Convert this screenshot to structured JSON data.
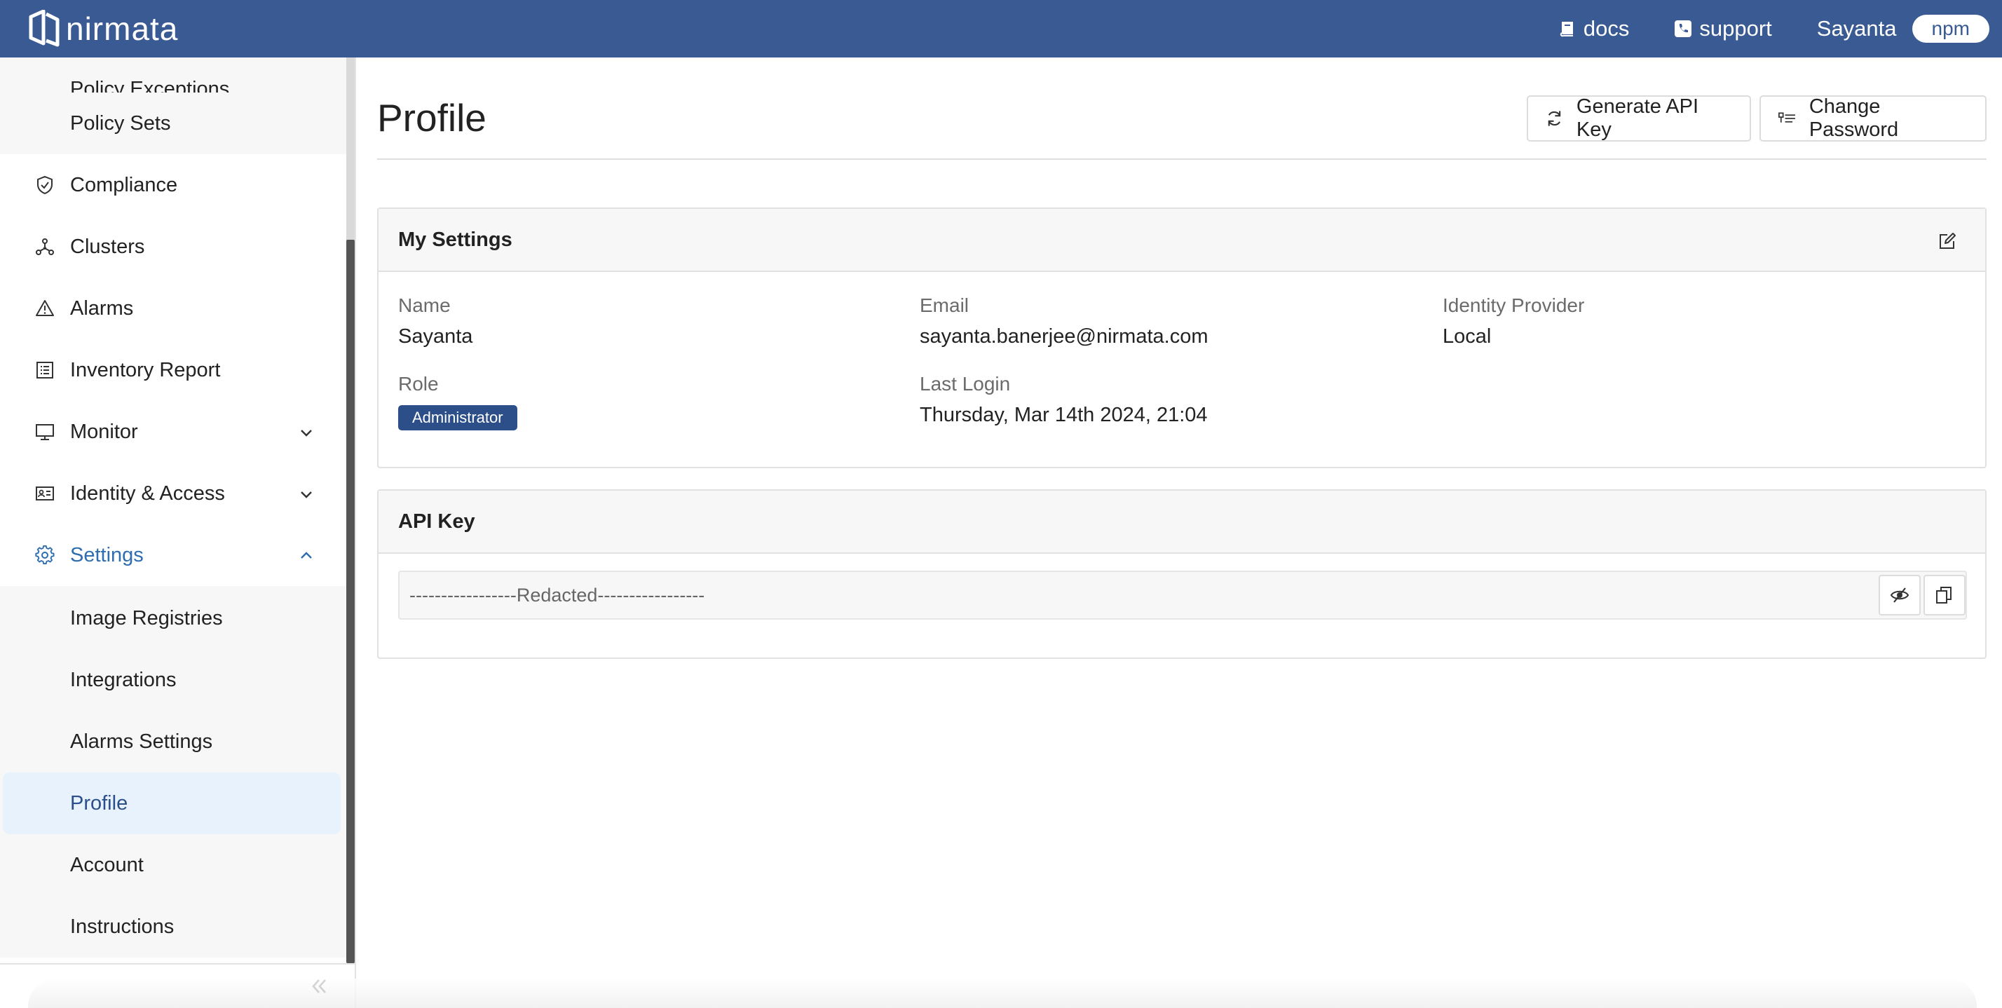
{
  "brand": {
    "name": "nirmata"
  },
  "topbar": {
    "docs_label": "docs",
    "support_label": "support",
    "user_name": "Sayanta",
    "tenant": "npm"
  },
  "sidebar": {
    "partial_item": "Policy Exceptions",
    "policy_sets": "Policy Sets",
    "items": [
      {
        "label": "Compliance",
        "icon": "shield-check-icon"
      },
      {
        "label": "Clusters",
        "icon": "cluster-icon"
      },
      {
        "label": "Alarms",
        "icon": "warning-icon"
      },
      {
        "label": "Inventory Report",
        "icon": "list-report-icon"
      },
      {
        "label": "Monitor",
        "icon": "monitor-icon"
      },
      {
        "label": "Identity & Access",
        "icon": "id-card-icon"
      },
      {
        "label": "Settings",
        "icon": "gear-icon"
      }
    ],
    "settings_sub": [
      {
        "label": "Image Registries"
      },
      {
        "label": "Integrations"
      },
      {
        "label": "Alarms Settings"
      },
      {
        "label": "Profile"
      },
      {
        "label": "Account"
      },
      {
        "label": "Instructions"
      }
    ],
    "selected": "Profile"
  },
  "page": {
    "title": "Profile",
    "generate_api_key": "Generate API Key",
    "change_password": "Change Password"
  },
  "settings_card": {
    "title": "My Settings",
    "name_label": "Name",
    "name_value": "Sayanta",
    "email_label": "Email",
    "email_value": "sayanta.banerjee@nirmata.com",
    "idp_label": "Identity Provider",
    "idp_value": "Local",
    "role_label": "Role",
    "role_value": "Administrator",
    "last_login_label": "Last Login",
    "last_login_value": "Thursday, Mar 14th 2024, 21:04"
  },
  "api_key_card": {
    "title": "API Key",
    "value": "-----------------Redacted-----------------"
  },
  "colors": {
    "topbar": "#3a5a93",
    "accent": "#2d6db0",
    "badge": "#2c4f8a",
    "selected_bg": "#e8f2fd"
  }
}
